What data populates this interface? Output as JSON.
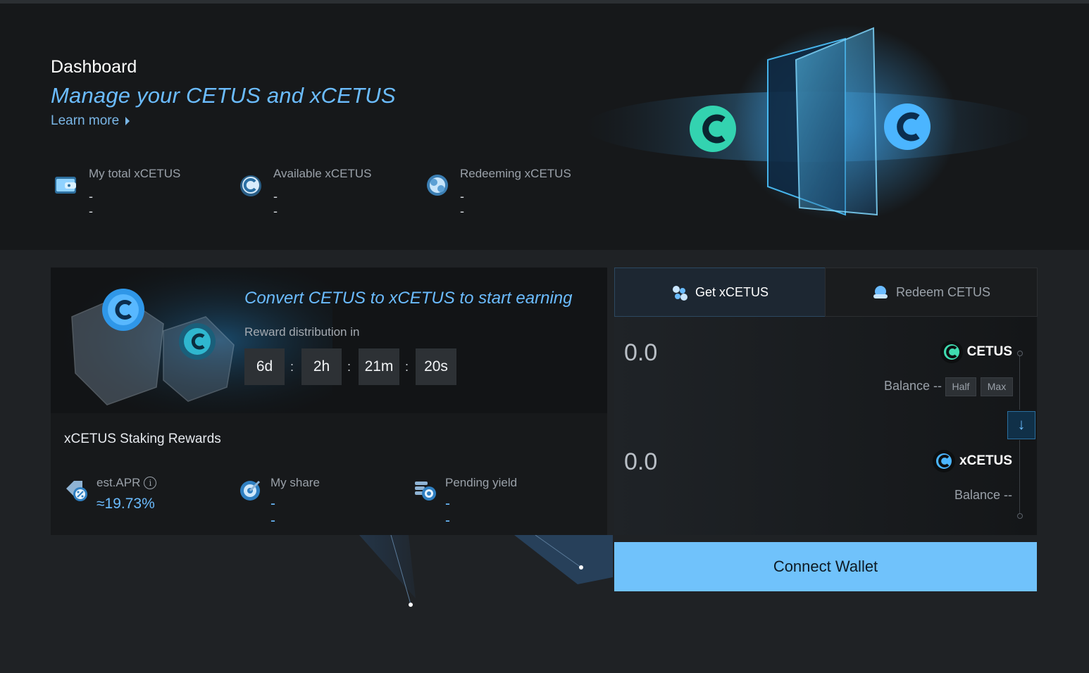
{
  "hero": {
    "title": "Dashboard",
    "subtitle": "Manage your CETUS and xCETUS",
    "learn_more": "Learn more",
    "stats": [
      {
        "label": "My total xCETUS",
        "value": "--",
        "icon": "wallet-card-icon"
      },
      {
        "label": "Available xCETUS",
        "value": "--",
        "icon": "xcetus-coin-icon"
      },
      {
        "label": "Redeeming xCETUS",
        "value": "--",
        "icon": "redeem-orb-icon"
      }
    ]
  },
  "promo": {
    "title": "Convert CETUS to xCETUS to start earning",
    "distribution_label": "Reward distribution in",
    "countdown": {
      "days": "6d",
      "hours": "2h",
      "minutes": "21m",
      "seconds": "20s",
      "separator": ":"
    }
  },
  "rewards": {
    "title": "xCETUS Staking Rewards",
    "apr_label": "est.APR",
    "apr_info": "i",
    "apr_value": "≈19.73%",
    "share_label": "My share",
    "share_value": "--",
    "pending_label": "Pending yield",
    "pending_value": "--"
  },
  "tabs": {
    "get": "Get xCETUS",
    "redeem": "Redeem CETUS"
  },
  "from": {
    "amount": "0.0",
    "token": "CETUS",
    "balance": "Balance --",
    "half": "Half",
    "max": "Max"
  },
  "to": {
    "amount": "0.0",
    "token": "xCETUS",
    "balance": "Balance --"
  },
  "swap_icon": "↓",
  "connect": "Connect Wallet",
  "colors": {
    "accent": "#6bbcff",
    "button": "#70c2fb",
    "hero_bg": "#16181a",
    "page_bg": "#1f2225"
  }
}
